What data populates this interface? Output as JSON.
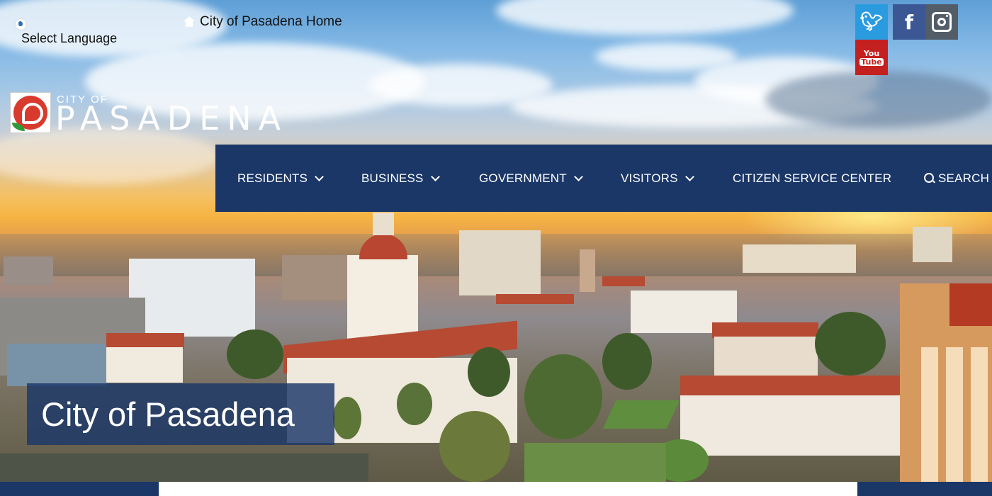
{
  "top_bar": {
    "language_label": "Select Language",
    "home_link_label": "City of Pasadena Home"
  },
  "social": {
    "twitter_icon": "twitter-icon",
    "facebook_icon": "facebook-icon",
    "instagram_icon": "instagram-icon",
    "youtube_top": "You",
    "youtube_bottom": "Tube"
  },
  "logo": {
    "small_text": "CITY OF",
    "big_text": "PASADENA"
  },
  "nav": {
    "items": [
      {
        "label": "RESIDENTS"
      },
      {
        "label": "BUSINESS"
      },
      {
        "label": "GOVERNMENT"
      },
      {
        "label": "VISITORS"
      },
      {
        "label": "CITIZEN SERVICE CENTER"
      },
      {
        "label": "SEARCH"
      }
    ]
  },
  "hero": {
    "banner_title": "City of Pasadena"
  },
  "colors": {
    "nav_bg": "#1b3768",
    "twitter": "#2b9be0",
    "facebook": "#3b5895",
    "instagram": "#525d68",
    "youtube": "#c3201f"
  }
}
